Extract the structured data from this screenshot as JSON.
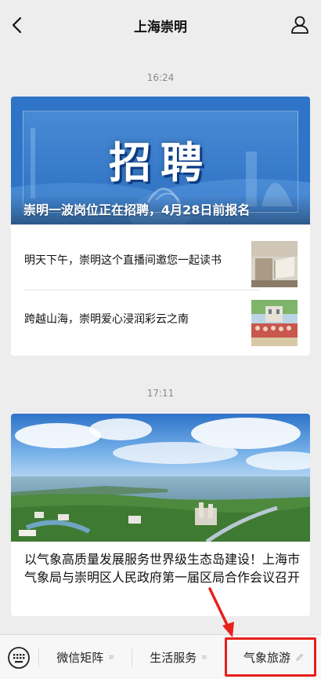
{
  "header": {
    "title": "上海崇明"
  },
  "messages": [
    {
      "time": "16:24",
      "hero": {
        "poster_title": "招聘",
        "caption": "崇明一波岗位正在招聘，4月28日前报名"
      },
      "items": [
        {
          "title": "明天下午，崇明这个直播间邀您一起读书"
        },
        {
          "title": "跨越山海，崇明爱心浸润彩云之南"
        }
      ]
    },
    {
      "time": "17:11",
      "hero": {
        "title": "以气象高质量发展服务世界级生态岛建设！上海市气象局与崇明区人民政府第一届区局合作会议召开"
      }
    }
  ],
  "bottom_menu": {
    "items": [
      {
        "label": "微信矩阵"
      },
      {
        "label": "生活服务"
      },
      {
        "label": "气象旅游"
      }
    ]
  },
  "icons": {
    "back": "chevron-left-icon",
    "profile": "person-icon",
    "keyboard": "keyboard-icon",
    "menu_dots": "list-icon",
    "edit": "pencil-icon"
  },
  "colors": {
    "background": "#ededed",
    "highlight": "#e8201a",
    "poster_blue": "#2d6fc0"
  }
}
